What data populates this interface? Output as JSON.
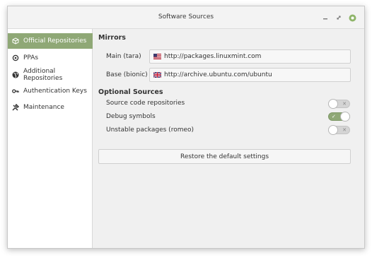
{
  "window": {
    "title": "Software Sources",
    "controls": [
      "minimize-icon",
      "maximize-icon",
      "close-icon"
    ]
  },
  "sidebar": {
    "items": [
      {
        "label": "Official Repositories",
        "icon": "package-icon",
        "active": true
      },
      {
        "label": "PPAs",
        "icon": "ppa-icon",
        "active": false
      },
      {
        "label": "Additional Repositories",
        "icon": "globe-icon",
        "active": false
      },
      {
        "label": "Authentication Keys",
        "icon": "key-icon",
        "active": false
      },
      {
        "label": "Maintenance",
        "icon": "tools-icon",
        "active": false
      }
    ]
  },
  "mirrors": {
    "heading": "Mirrors",
    "main": {
      "label": "Main (tara)",
      "url": "http://packages.linuxmint.com",
      "flag": "us-flag-icon"
    },
    "base": {
      "label": "Base (bionic)",
      "url": "http://archive.ubuntu.com/ubuntu",
      "flag": "uk-flag-icon"
    }
  },
  "optional": {
    "heading": "Optional Sources",
    "items": [
      {
        "label": "Source code repositories",
        "enabled": false
      },
      {
        "label": "Debug symbols",
        "enabled": true
      },
      {
        "label": "Unstable packages (romeo)",
        "enabled": false
      }
    ]
  },
  "restore_button": "Restore the default settings",
  "colors": {
    "accent": "#8fa876"
  }
}
